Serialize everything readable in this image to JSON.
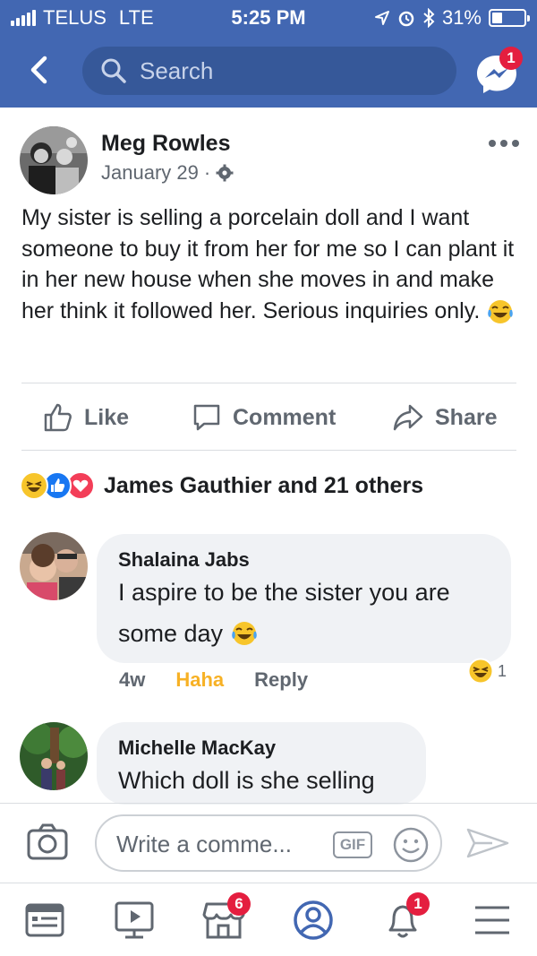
{
  "status_bar": {
    "carrier": "TELUS",
    "network": "LTE",
    "time": "5:25 PM",
    "battery": "31%",
    "battery_level": 0.31
  },
  "header": {
    "search_placeholder": "Search",
    "messenger_badge": "1"
  },
  "post": {
    "author": "Meg Rowles",
    "date": "January 29",
    "date_separator": "·",
    "text": "My sister is selling a porcelain doll and I want someone to buy it from her for me so I can plant it in her new house when she moves in and make her think it followed her. Serious inquiries only.",
    "actions": {
      "like": "Like",
      "comment": "Comment",
      "share": "Share"
    },
    "reactions_summary": "James Gauthier and 21 others"
  },
  "comments": [
    {
      "author": "Shalaina Jabs",
      "text_line1": "I aspire to be the sister you are",
      "text_line2": "some day",
      "time": "4w",
      "haha": "Haha",
      "reply": "Reply",
      "reaction_count": "1"
    },
    {
      "author": "Michelle MacKay",
      "text": "Which doll is she selling"
    }
  ],
  "composer": {
    "placeholder": "Write a comme...",
    "gif_label": "GIF"
  },
  "bottom_nav": {
    "marketplace_badge": "6",
    "notifications_badge": "1"
  },
  "colors": {
    "brand_blue": "#4267b2",
    "badge_red": "#e41e3f",
    "haha_yellow": "#f7b125"
  }
}
